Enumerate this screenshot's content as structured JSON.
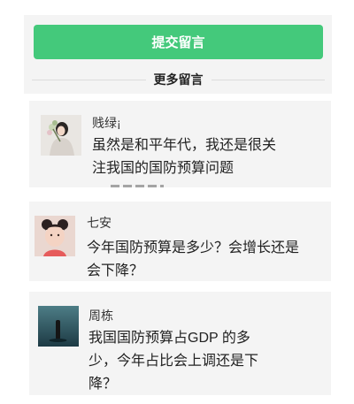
{
  "actions": {
    "submit_label": "提交留言",
    "more_label": "更多留言"
  },
  "comments": [
    {
      "name": "贱绿¡",
      "text": "虽然是和平年代，我还是很关注我国的国防预算问题",
      "avatar": "avatar-woman-with-flowers"
    },
    {
      "name": "七安",
      "text": "今年国防预算是多少？会增长还是会下降？",
      "avatar": "avatar-girl-with-buns"
    },
    {
      "name": "周栋",
      "text": "我国国防预算占GDP 的多少，今年占比会上调还是下降？",
      "avatar": "avatar-dark-landscape"
    }
  ]
}
